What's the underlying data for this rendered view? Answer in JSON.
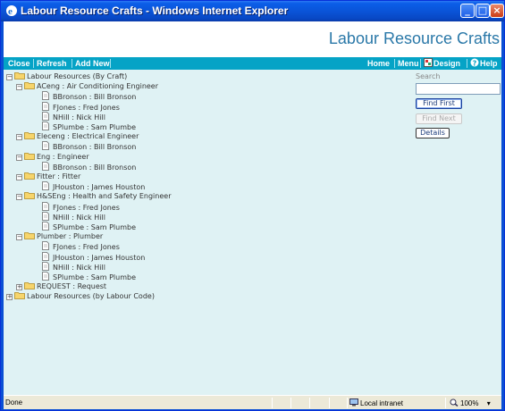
{
  "window": {
    "title": "Labour Resource Crafts - Windows Internet Explorer"
  },
  "header": {
    "title": "Labour Resource Crafts"
  },
  "toolbar": {
    "close": "Close",
    "refresh": "Refresh",
    "add_new": "Add New",
    "home": "Home",
    "menu": "Menu",
    "design": "Design",
    "help": "Help"
  },
  "tree": {
    "root1": "Labour Resources (By Craft)",
    "root2": "Labour Resources (by Labour Code)",
    "crafts": [
      {
        "label": "ACeng : Air Conditioning Engineer",
        "children": [
          "BBronson : Bill Bronson",
          "FJones : Fred Jones",
          "NHill : Nick Hill",
          "SPlumbe : Sam Plumbe"
        ]
      },
      {
        "label": "Eleceng : Electrical Engineer",
        "children": [
          "BBronson : Bill Bronson"
        ]
      },
      {
        "label": "Eng : Engineer",
        "children": [
          "BBronson : Bill Bronson"
        ]
      },
      {
        "label": "Fitter : Fitter",
        "children": [
          "JHouston : James Houston"
        ]
      },
      {
        "label": "H&SEng : Health and Safety Engineer",
        "children": [
          "FJones : Fred Jones",
          "NHill : Nick Hill",
          "SPlumbe : Sam Plumbe"
        ]
      },
      {
        "label": "Plumber : Plumber",
        "children": [
          "FJones : Fred Jones",
          "JHouston : James Houston",
          "NHill : Nick Hill",
          "SPlumbe : Sam Plumbe"
        ]
      },
      {
        "label": "REQUEST : Request",
        "children": []
      }
    ]
  },
  "search": {
    "label": "Search",
    "value": "",
    "find_first": "Find First",
    "find_next": "Find Next",
    "details": "Details"
  },
  "status": {
    "left": "Done",
    "zone": "Local intranet",
    "zoom": "100%"
  }
}
